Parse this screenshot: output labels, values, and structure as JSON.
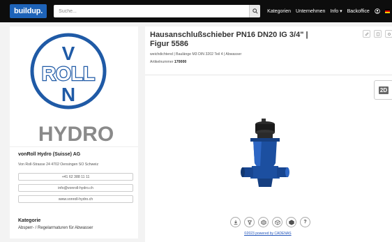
{
  "navbar": {
    "logo": "buildup.",
    "search_placeholder": "Suche...",
    "links": [
      "Kategorien",
      "Unternehmen",
      "Info ▾",
      "Backoffice"
    ]
  },
  "company": {
    "logo_text_1": "V",
    "logo_text_2": "ROLL",
    "logo_text_3": "N",
    "logo_hydro": "HYDRO",
    "name": "vonRoll Hydro (Suisse) AG",
    "address": "Von Roll-Strasse 24 4702 Oensingen SO Schweiz",
    "phone": "+41 62 388 11 11",
    "email": "info@vonroll-hydro.ch",
    "website": "www.vonroll-hydro.ch"
  },
  "category": {
    "title": "Kategorie",
    "value": "Absperr- / Regelarmaturen für Abwasser"
  },
  "product": {
    "title_line1": "Hausanschlußschieber PN16 DN20 IG 3/4\" |",
    "title_line2": "Figur 5586",
    "subtitle": "weichdichtend | Baulänge M3 DIN 3202 Teil 4 | Abwasser",
    "article_label": "Artikelnummer",
    "article_number": "170000"
  },
  "viewer": {
    "toggle_label": "2D",
    "credit": "©2023 powered by CADENAS"
  },
  "colors": {
    "navbar_bg": "#0d0d0d",
    "brand_blue": "#1e63b8",
    "vonroll_blue": "#1f5aa6",
    "hydro_gray": "#8a8a8a",
    "valve_blue": "#1c4fa0"
  }
}
